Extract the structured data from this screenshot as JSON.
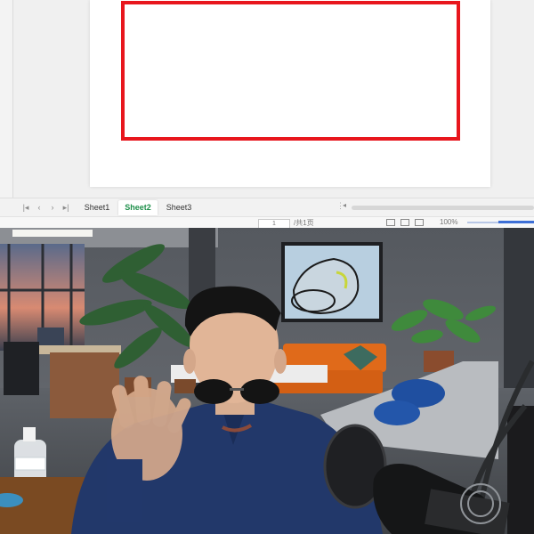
{
  "sheets": {
    "tabs": [
      {
        "label": "Sheet1",
        "active": false
      },
      {
        "label": "Sheet2",
        "active": true
      },
      {
        "label": "Sheet3",
        "active": false
      }
    ]
  },
  "status": {
    "page_number": "1",
    "page_total": "/共1页",
    "zoom": "100%"
  },
  "colors": {
    "rect_border": "#e8161d",
    "active_tab_text": "#1e8f4a",
    "zoom_accent": "#3d6fd6"
  },
  "icons": [
    "first-sheet-icon",
    "prev-sheet-icon",
    "next-sheet-icon",
    "last-sheet-icon",
    "cursor-crosshair-icon",
    "normal-view-icon",
    "page-layout-icon",
    "page-break-view-icon"
  ]
}
